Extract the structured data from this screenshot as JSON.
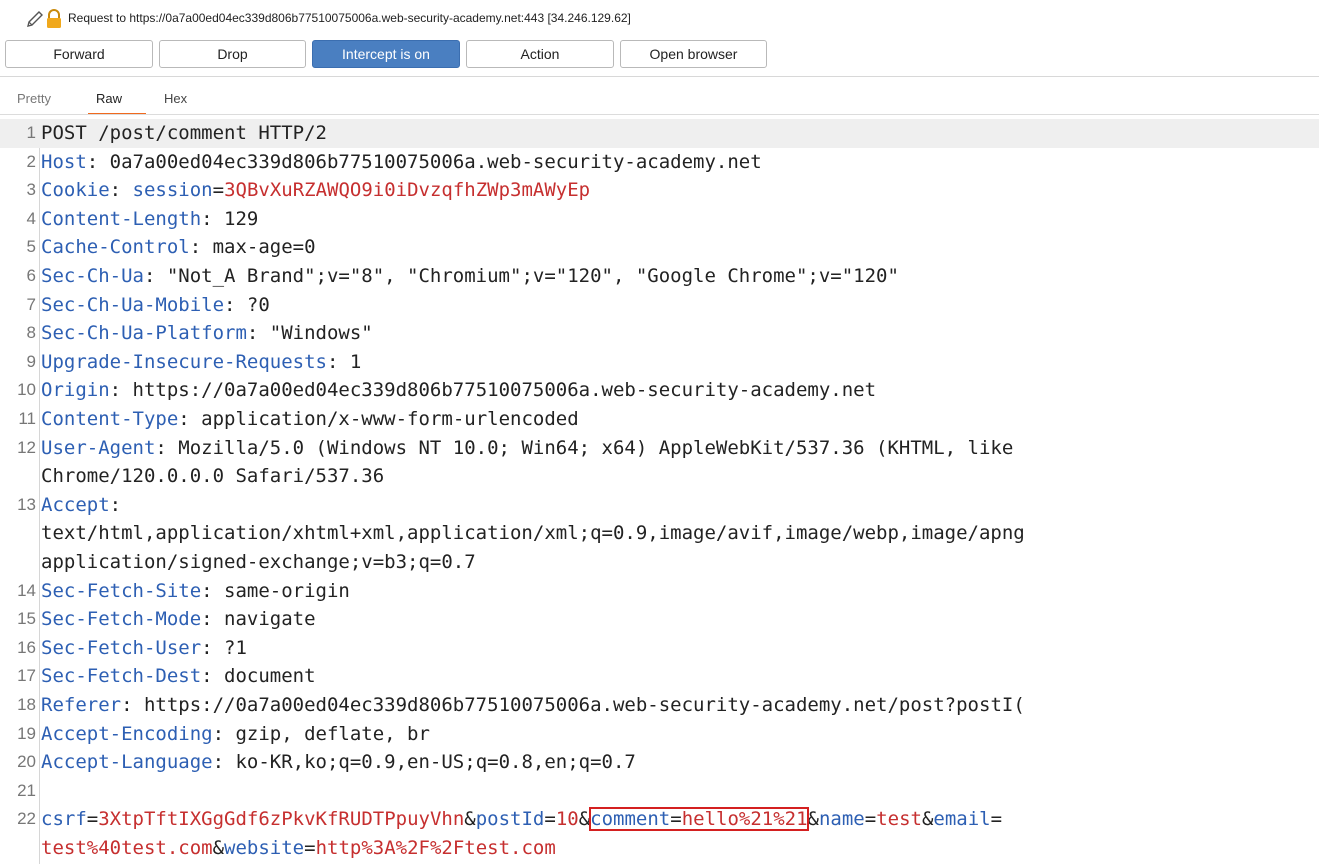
{
  "request_bar": {
    "text": "Request to https://0a7a00ed04ec339d806b77510075006a.web-security-academy.net:443  [34.246.129.62]",
    "icons": [
      "pencil-icon",
      "lock-icon"
    ],
    "lock_color": "#e8a317"
  },
  "toolbar": {
    "forward": "Forward",
    "drop": "Drop",
    "intercept": "Intercept is on",
    "action": "Action",
    "open_browser": "Open browser"
  },
  "tabs": {
    "pretty": "Pretty",
    "raw": "Raw",
    "hex": "Hex",
    "active": "Raw"
  },
  "colors": {
    "accent": "#f06a1e",
    "intercept_on": "#4a7fc1",
    "header_key": "#2d5fb3",
    "param_value": "#c62f2f",
    "highlight_box": "#d42020"
  },
  "lines": [
    {
      "n": "1",
      "text": "POST /post/comment HTTP/2"
    },
    {
      "n": "2",
      "key": "Host",
      "val": ": 0a7a00ed04ec339d806b77510075006a.web-security-academy.net"
    },
    {
      "n": "3",
      "key": "Cookie",
      "sep": ": ",
      "ckey": "session",
      "eq": "=",
      "cval": "3QBvXuRZAWQO9i0iDvzqfhZWp3mAWyEp"
    },
    {
      "n": "4",
      "key": "Content-Length",
      "val": ": 129"
    },
    {
      "n": "5",
      "key": "Cache-Control",
      "val": ": max-age=0"
    },
    {
      "n": "6",
      "key": "Sec-Ch-Ua",
      "val": ": \"Not_A Brand\";v=\"8\", \"Chromium\";v=\"120\", \"Google Chrome\";v=\"120\""
    },
    {
      "n": "7",
      "key": "Sec-Ch-Ua-Mobile",
      "val": ": ?0"
    },
    {
      "n": "8",
      "key": "Sec-Ch-Ua-Platform",
      "val": ": \"Windows\""
    },
    {
      "n": "9",
      "key": "Upgrade-Insecure-Requests",
      "val": ": 1"
    },
    {
      "n": "10",
      "key": "Origin",
      "val": ": https://0a7a00ed04ec339d806b77510075006a.web-security-academy.net"
    },
    {
      "n": "11",
      "key": "Content-Type",
      "val": ": application/x-www-form-urlencoded"
    },
    {
      "n": "12",
      "key": "User-Agent",
      "val": ": Mozilla/5.0 (Windows NT 10.0; Win64; x64) AppleWebKit/537.36 (KHTML, like",
      "cont": "Chrome/120.0.0.0 Safari/537.36"
    },
    {
      "n": "13",
      "key": "Accept",
      "val": ":",
      "cont": "text/html,application/xhtml+xml,application/xml;q=0.9,image/avif,image/webp,image/apng",
      "cont2": "application/signed-exchange;v=b3;q=0.7"
    },
    {
      "n": "14",
      "key": "Sec-Fetch-Site",
      "val": ": same-origin"
    },
    {
      "n": "15",
      "key": "Sec-Fetch-Mode",
      "val": ": navigate"
    },
    {
      "n": "16",
      "key": "Sec-Fetch-User",
      "val": ": ?1"
    },
    {
      "n": "17",
      "key": "Sec-Fetch-Dest",
      "val": ": document"
    },
    {
      "n": "18",
      "key": "Referer",
      "val": ": https://0a7a00ed04ec339d806b77510075006a.web-security-academy.net/post?postI("
    },
    {
      "n": "19",
      "key": "Accept-Encoding",
      "val": ": gzip, deflate, br"
    },
    {
      "n": "20",
      "key": "Accept-Language",
      "val": ": ko-KR,ko;q=0.9,en-US;q=0.8,en;q=0.7"
    },
    {
      "n": "21",
      "text": ""
    },
    {
      "n": "22",
      "p1k": "csrf",
      "p1v": "3XtpTftIXGgGdf6zPkvKfRUDTPpuyVhn",
      "amp": "&",
      "p2k": "postId",
      "p2v": "10",
      "p3k": "comment",
      "p3v": "hello%21%21",
      "p4k": "name",
      "p4v": "test",
      "p5k": "email",
      "eq": "=",
      "cont_val": "test%40test.com",
      "p6k": "website",
      "p6v": "http%3A%2F%2Ftest.com"
    }
  ]
}
